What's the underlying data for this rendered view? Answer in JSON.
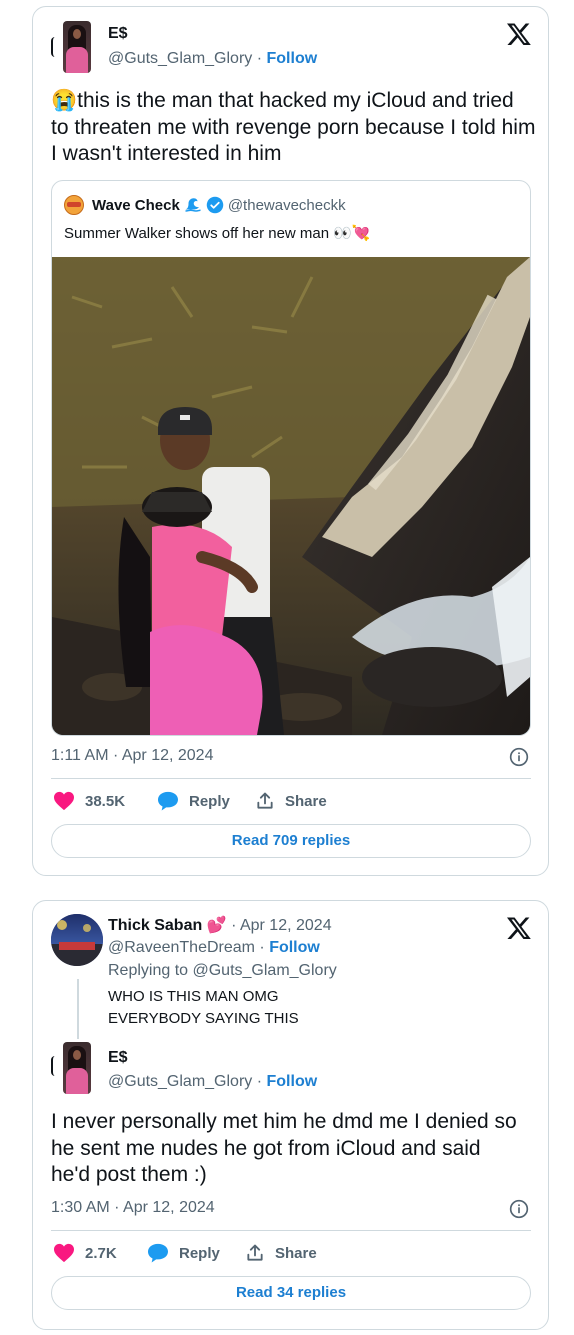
{
  "tweet1": {
    "author_name": "E$",
    "handle": "@Guts_Glam_Glory",
    "separator": " · ",
    "follow_label": "Follow",
    "text": "this is the man that hacked my iCloud  and tried to threaten me with revenge porn because I told him I wasn't interested in him",
    "emoji": "😭",
    "quote": {
      "name": "Wave Check",
      "handle": "@thewavecheckk",
      "text": "Summer Walker shows off her new man 👀💘"
    },
    "time": "1:11 AM · Apr 12, 2024",
    "likes": "38.5K",
    "reply_label": "Reply",
    "share_label": "Share",
    "read_replies": "Read 709 replies"
  },
  "tweet2": {
    "author_name": "Thick Saban",
    "author_emoji": "💕",
    "date": " · Apr 12, 2024",
    "handle": "@RaveenTheDream",
    "separator": " · ",
    "follow_label": "Follow",
    "replying_to": "Replying to @Guts_Glam_Glory",
    "text_line1": "WHO IS THIS MAN OMG",
    "text_line2": "EVERYBODY SAYING THIS",
    "reply": {
      "author_name": "E$",
      "handle": "@Guts_Glam_Glory",
      "separator": " · ",
      "follow_label": "Follow",
      "text": "I never personally met him he dmd me I denied so he sent me nudes he got from iCloud and said he'd post them :)",
      "time": "1:30 AM · Apr 12, 2024",
      "likes": "2.7K",
      "reply_label": "Reply",
      "share_label": "Share",
      "read_replies": "Read 34 replies"
    }
  },
  "colors": {
    "accent": "#1d7fd1",
    "like": "#f91880",
    "reply": "#1d9bf0",
    "muted": "#536471"
  },
  "icons": [
    "x-logo-icon",
    "heart-icon",
    "comment-icon",
    "share-icon",
    "info-icon",
    "verified-badge-icon",
    "wave-icon"
  ]
}
